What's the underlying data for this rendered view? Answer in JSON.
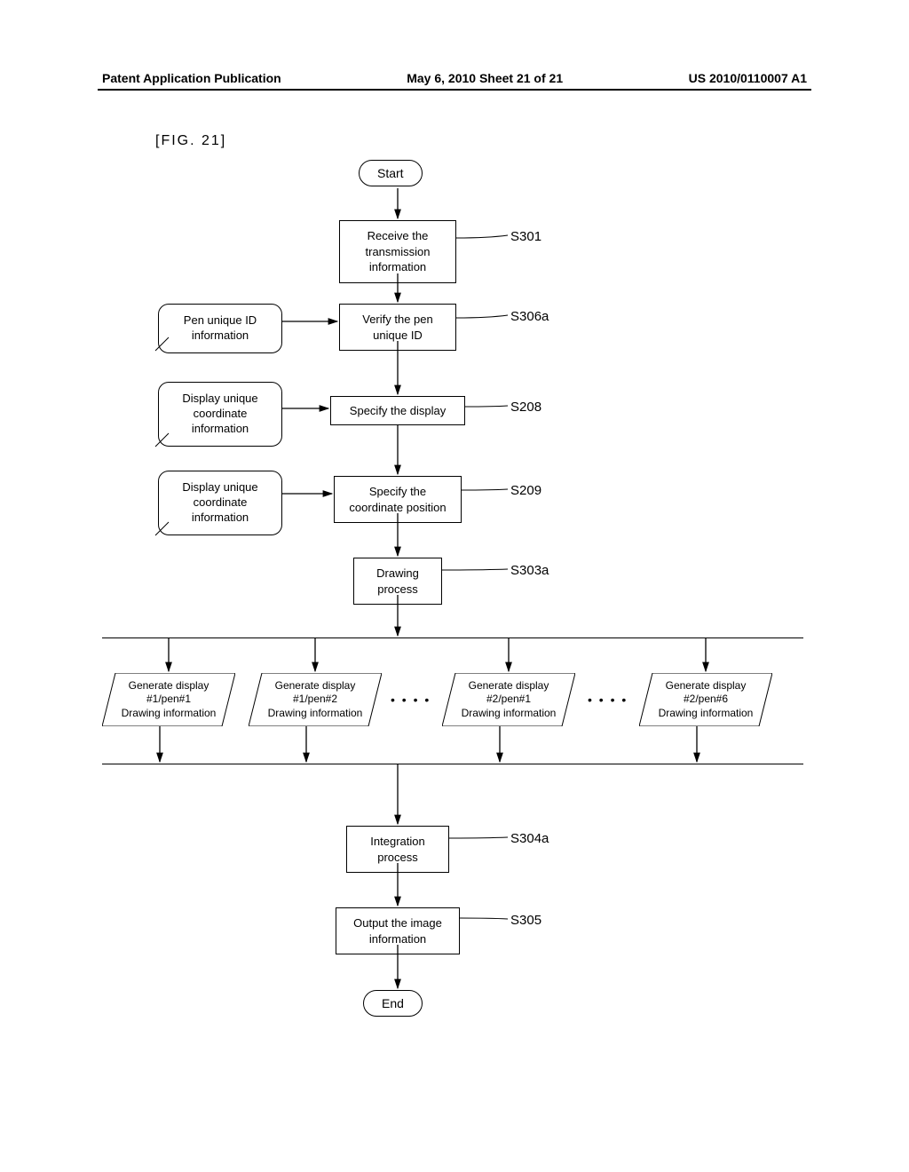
{
  "header": {
    "left": "Patent Application Publication",
    "center": "May 6, 2010  Sheet 21 of 21",
    "right": "US 2010/0110007 A1"
  },
  "fig_label": "[FIG. 21]",
  "flow": {
    "start": "Start",
    "end": "End",
    "s301": {
      "text": "Receive the\ntransmission\ninformation",
      "label": "S301"
    },
    "s306a": {
      "text": "Verify the pen\nunique ID",
      "label": "S306a"
    },
    "s208": {
      "text": "Specify the display",
      "label": "S208"
    },
    "s209": {
      "text": "Specify the\ncoordinate position",
      "label": "S209"
    },
    "s303a": {
      "text": "Drawing\nprocess",
      "label": "S303a"
    },
    "s304a": {
      "text": "Integration\nprocess",
      "label": "S304a"
    },
    "s305": {
      "text": "Output the image\ninformation",
      "label": "S305"
    }
  },
  "inputs": {
    "pen_id": "Pen unique ID\ninformation",
    "disp_coord1": "Display unique\ncoordinate\ninformation",
    "disp_coord2": "Display unique\ncoordinate\ninformation"
  },
  "parallels": {
    "p1": "Generate display\n#1/pen#1\nDrawing information",
    "p2": "Generate display\n#1/pen#2\nDrawing information",
    "p3": "Generate display\n#2/pen#1\nDrawing information",
    "p4": "Generate display\n#2/pen#6\nDrawing information"
  },
  "dots": "• • • •"
}
